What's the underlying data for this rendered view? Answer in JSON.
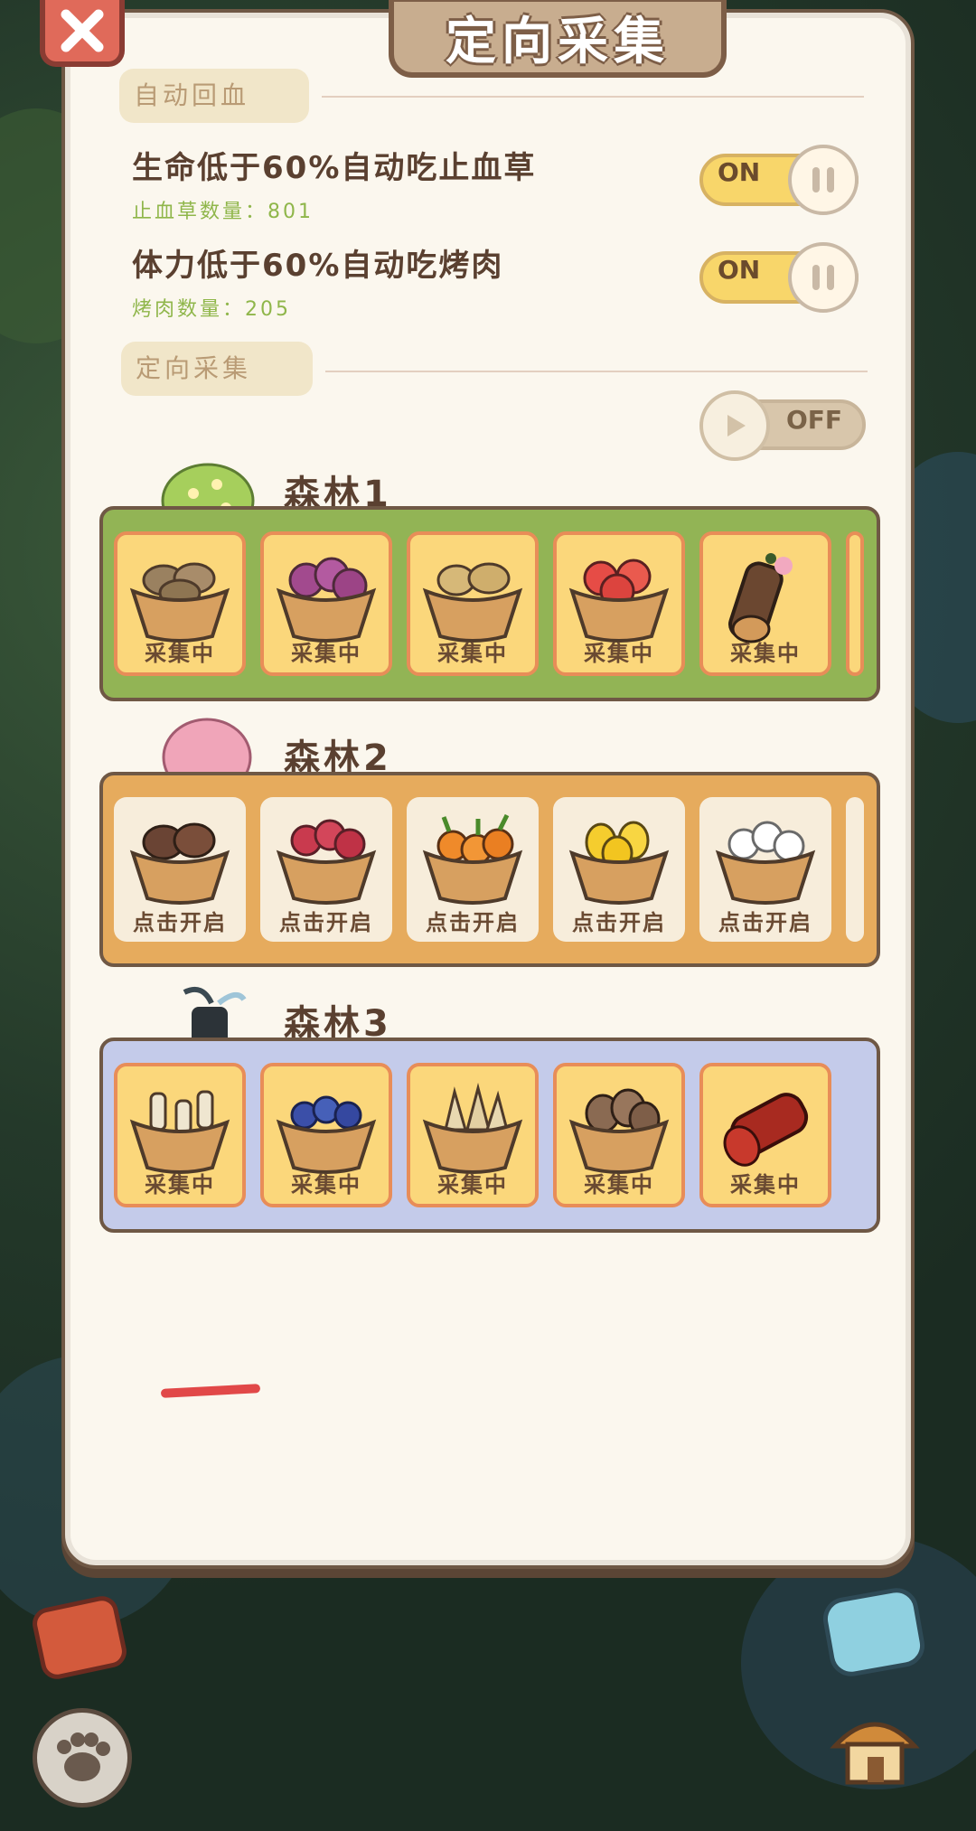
{
  "colors": {
    "panel_bg": "#fbf7ee",
    "forest1_bg": "#92b455",
    "forest2_bg": "#e6ab5d",
    "forest3_bg": "#c4cbea",
    "tile_active": "#fbd77b",
    "tile_locked": "#f7eddb",
    "accent_green": "#8fb64a"
  },
  "header": {
    "title": "定向采集",
    "close_icon": "close-x-icon"
  },
  "auto_heal": {
    "section_label": "自动回血",
    "settings": [
      {
        "title": "生命低于60%自动吃止血草",
        "subtitle": "止血草数量：801",
        "toggle": "ON"
      },
      {
        "title": "体力低于60%自动吃烤肉",
        "subtitle": "烤肉数量：205",
        "toggle": "ON"
      }
    ]
  },
  "directed": {
    "section_label": "定向采集",
    "toggle": "OFF"
  },
  "forests": [
    {
      "name": "森林1",
      "bg": "#92b455",
      "icon": "flower-bush-icon",
      "tiles": [
        {
          "item": "potato-basket-icon",
          "label": "采集中",
          "active": true
        },
        {
          "item": "purple-flower-basket-icon",
          "label": "采集中",
          "active": true
        },
        {
          "item": "yellow-potato-basket-icon",
          "label": "采集中",
          "active": true
        },
        {
          "item": "apple-basket-icon",
          "label": "采集中",
          "active": true
        },
        {
          "item": "blossom-log-icon",
          "label": "采集中",
          "active": true
        }
      ]
    },
    {
      "name": "森林2",
      "bg": "#e6ab5d",
      "icon": "pink-bush-icon",
      "tiles": [
        {
          "item": "sweet-potato-basket-icon",
          "label": "点击开启",
          "active": false
        },
        {
          "item": "raspberry-basket-icon",
          "label": "点击开启",
          "active": false
        },
        {
          "item": "carrot-basket-icon",
          "label": "点击开启",
          "active": false
        },
        {
          "item": "mango-basket-icon",
          "label": "点击开启",
          "active": false
        },
        {
          "item": "cotton-basket-icon",
          "label": "点击开启",
          "active": false
        }
      ]
    },
    {
      "name": "森林3",
      "bg": "#c4cbea",
      "icon": "dark-stump-icon",
      "tiles": [
        {
          "item": "mushroom-basket-icon",
          "label": "采集中",
          "active": true
        },
        {
          "item": "blueberry-basket-icon",
          "label": "采集中",
          "active": true
        },
        {
          "item": "bamboo-shoot-basket-icon",
          "label": "采集中",
          "active": true
        },
        {
          "item": "taro-basket-icon",
          "label": "采集中",
          "active": true
        },
        {
          "item": "red-log-icon",
          "label": "采集中",
          "active": true
        }
      ]
    }
  ]
}
